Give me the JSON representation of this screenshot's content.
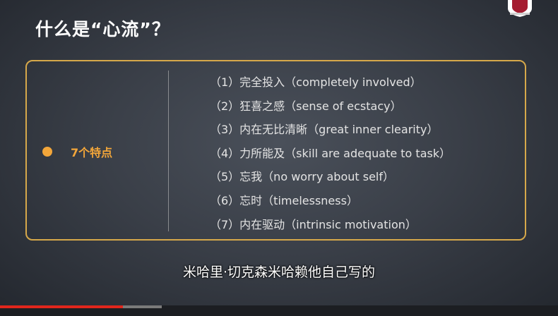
{
  "slide": {
    "title": "什么是“心流”？",
    "category_label": "7个特点",
    "features": [
      "（1）完全投入（completely involved）",
      "（2）狂喜之感（sense of ecstacy）",
      "（3）内在无比清晰（great inner clearity）",
      "（4）力所能及（skill are adequate to task）",
      "（5）忘我（no worry about self）",
      "（6）忘时（timelessness）",
      "（7）内在驱动（intrinsic motivation）"
    ]
  },
  "subtitle": "米哈里·切克森米哈赖他自己写的",
  "logo": {
    "icon": "university-shield-icon",
    "banner_color": "#a51c30"
  },
  "progress": {
    "played_fraction": 0.22,
    "buffered_fraction": 0.29,
    "played_color": "#e0261c",
    "buffered_color": "#7a7a7a"
  },
  "colors": {
    "accent": "#f3a63a",
    "panel_border": "#d6a84a"
  }
}
